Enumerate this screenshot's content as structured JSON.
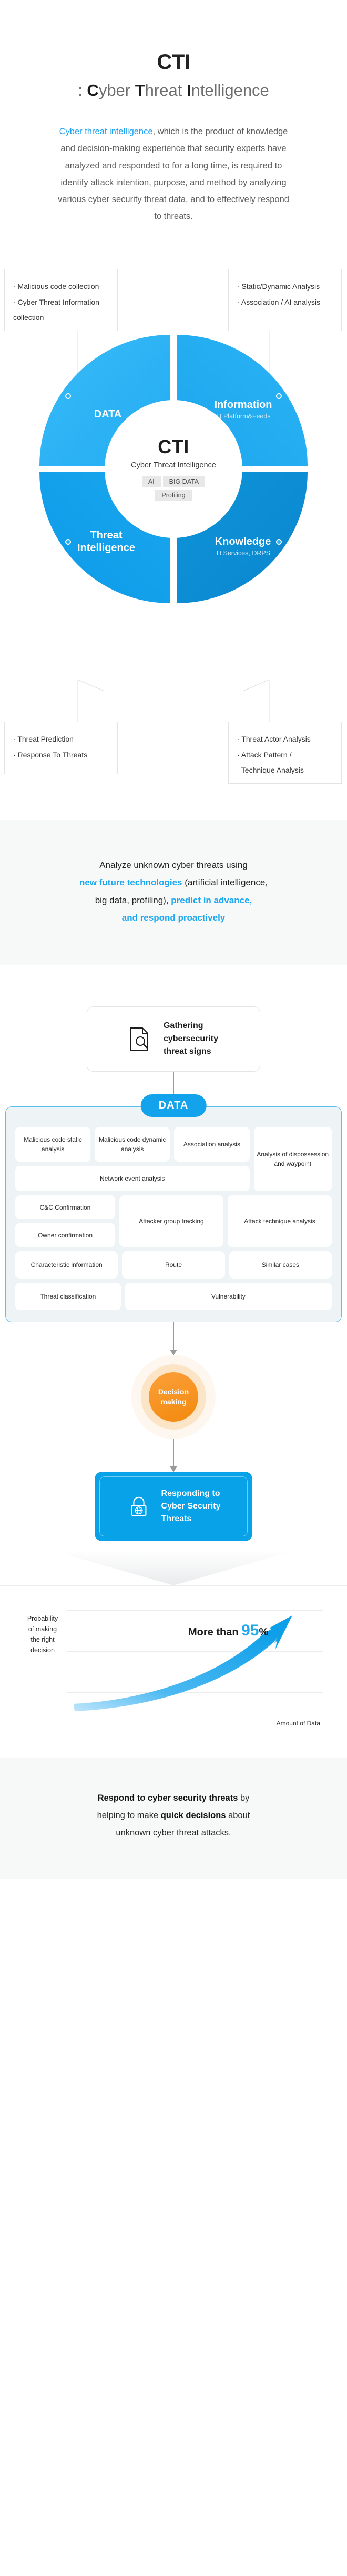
{
  "header": {
    "title": "CTI",
    "subtitle_prefix": ": ",
    "subtitle_c": "C",
    "subtitle_yber": "yber ",
    "subtitle_t": "T",
    "subtitle_hreat": "hreat ",
    "subtitle_i": "I",
    "subtitle_ntelligence": "ntelligence"
  },
  "intro": {
    "highlight": "Cyber threat intelligence",
    "body": ", which is the product of knowledge and decision-making experience that security experts have analyzed and responded to for a long time, is required to identify attack intention, purpose, and method by analyzing various cyber security threat data, and to effectively respond to threats."
  },
  "diagram": {
    "boxes": {
      "top_left": [
        "· Malicious code collection",
        "· Cyber Threat Information collection"
      ],
      "top_right": [
        "· Static/Dynamic Analysis",
        "· Association / AI analysis"
      ],
      "bottom_left": [
        "· Threat Prediction",
        "· Response To Threats"
      ],
      "bottom_right": [
        "· Threat Actor Analysis",
        "· Attack Pattern / Technique Analysis"
      ]
    },
    "segments": [
      {
        "title": "DATA",
        "subtitle": ""
      },
      {
        "title": "Information",
        "subtitle": "TI Platform&Feeds"
      },
      {
        "title": "Threat\nIntelligence",
        "subtitle": ""
      },
      {
        "title": "Knowledge",
        "subtitle": "TI Services, DRPS"
      }
    ],
    "segment_data_title": "DATA",
    "segment_info_title": "Information",
    "segment_info_sub": "TI Platform&Feeds",
    "segment_ti_title_1": "Threat",
    "segment_ti_title_2": "Intelligence",
    "segment_know_title": "Knowledge",
    "segment_know_sub": "TI Services, DRPS",
    "hub": {
      "acronym": "CTI",
      "full": "Cyber Threat Intelligence",
      "tag_ai": "AI",
      "tag_bigdata": "BIG DATA",
      "tag_profiling": "Profiling"
    },
    "accent_color": "#13a3ec"
  },
  "band": {
    "line1": "Analyze unknown cyber threats using",
    "line2_blue": "new future technologies",
    "line2_rest": " (artificial intelligence,",
    "line3_rest": "big data, profiling), ",
    "line3_blue": "predict in advance,",
    "line4_blue": "and respond proactively"
  },
  "flow": {
    "gather_icon": "document-search-icon",
    "gather_line1": "Gathering",
    "gather_line2": "cybersecurity",
    "gather_line3": "threat signs",
    "data_pill": "DATA",
    "data_cells": {
      "r1c1": "Malicious code static analysis",
      "r1c2": "Malicious code dynamic analysis",
      "r1c3": "Association analysis",
      "r1c4": "Analysis of dispossession and waypoint",
      "r2_wide": "Network event analysis",
      "r3c1a": "C&C Confirmation",
      "r3c1b": "Owner confirmation",
      "r3c2": "Attacker group tracking",
      "r3c3": "Attack technique analysis",
      "r4c1": "Characteristic information",
      "r4c2": "Route",
      "r4c3": "Similar cases",
      "r5c1": "Threat classification",
      "r5_wide": "Vulnerability"
    },
    "decision_line1": "Decision",
    "decision_line2": "making",
    "respond_icon": "lock-globe-icon",
    "respond_line1": "Responding to",
    "respond_line2": "Cyber Security",
    "respond_line3": "Threats"
  },
  "chart_data": {
    "type": "line",
    "title": "",
    "ylabel": "Probability of making the right decision",
    "xlabel": "Amount of Data",
    "annotation_prefix": "More than ",
    "annotation_value": "95",
    "annotation_suffix": "%",
    "grid": true,
    "x": [
      0,
      10,
      20,
      30,
      40,
      50,
      60,
      70,
      80,
      90,
      100
    ],
    "values": [
      4,
      5,
      7,
      10,
      14,
      20,
      28,
      40,
      55,
      74,
      95
    ],
    "ylim": [
      0,
      100
    ],
    "xlim": [
      0,
      100
    ],
    "series_color": "#1fa8ef"
  },
  "footer": {
    "part1": "Respond to cyber security threats",
    "part2": " by",
    "part3": "helping to make ",
    "part4": "quick decisions",
    "part5": " about",
    "part6": "unknown cyber threat attacks."
  }
}
